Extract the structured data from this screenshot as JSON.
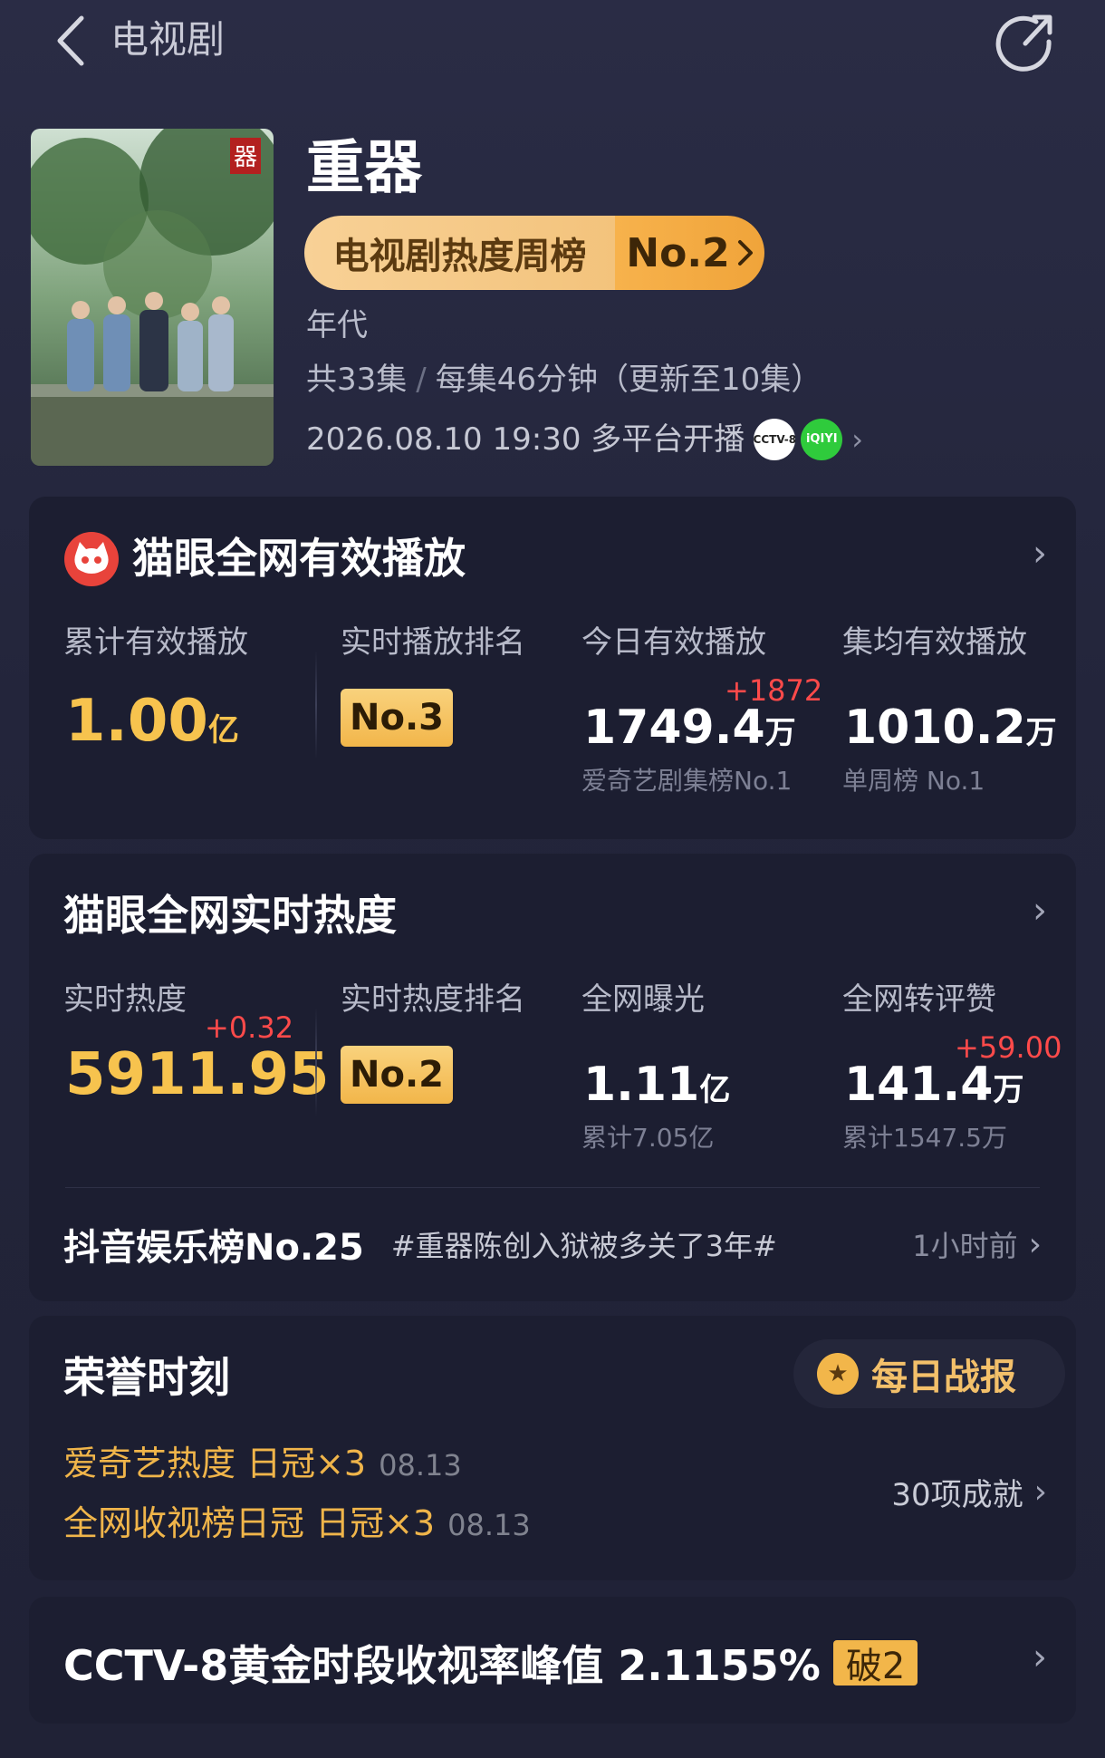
{
  "header": {
    "title": "电视剧"
  },
  "show": {
    "title": "重器",
    "poster_text": "器",
    "weekly_rank_label": "电视剧热度周榜",
    "weekly_rank_value": "No.2",
    "genre": "年代",
    "episodes": "共33集",
    "duration": "每集46分钟（更新至10集）",
    "premiere": "2026.08.10 19:30 多平台开播",
    "platforms": [
      "CCTV-8",
      "iQIYI"
    ]
  },
  "play_card": {
    "title": "猫眼全网有效播放",
    "cumulative": {
      "label": "累计有效播放",
      "value": "1.00",
      "unit": "亿"
    },
    "rank": {
      "label": "实时播放排名",
      "value": "No.3"
    },
    "today": {
      "label": "今日有效播放",
      "value": "1749.4",
      "unit": "万",
      "delta": "+1872",
      "sub": "爱奇艺剧集榜No.1"
    },
    "per_episode": {
      "label": "集均有效播放",
      "value": "1010.2",
      "unit": "万",
      "sub": "单周榜 No.1"
    }
  },
  "heat_card": {
    "title": "猫眼全网实时热度",
    "heat": {
      "label": "实时热度",
      "value": "5911.95",
      "delta": "+0.32"
    },
    "rank": {
      "label": "实时热度排名",
      "value": "No.2"
    },
    "exposure": {
      "label": "全网曝光",
      "value": "1.11",
      "unit": "亿",
      "sub": "累计7.05亿"
    },
    "engagement": {
      "label": "全网转评赞",
      "value": "141.4",
      "unit": "万",
      "delta": "+59.00",
      "sub": "累计1547.5万"
    },
    "douyin": {
      "label": "抖音娱乐榜No.25",
      "topic": "#重器陈创入狱被多关了3年#",
      "time": "1小时前"
    }
  },
  "honor_card": {
    "title": "荣誉时刻",
    "daily_button": "每日战报",
    "items": [
      {
        "text": "爱奇艺热度 日冠×3",
        "date": "08.13"
      },
      {
        "text": "全网收视榜日冠 日冠×3",
        "date": "08.13"
      }
    ],
    "achievements": "30项成就"
  },
  "rating_card": {
    "text": "CCTV-8黄金时段收视率峰值 2.1155%",
    "badge": "破2"
  },
  "icons": [
    "back-icon",
    "share-icon",
    "maoyan-logo-icon",
    "medal-icon",
    "chevron-right-icon"
  ],
  "colors": {
    "accent_gold": "#f7c34e",
    "delta_red": "#ff4a4a",
    "card_bg": "#1c1e31"
  }
}
